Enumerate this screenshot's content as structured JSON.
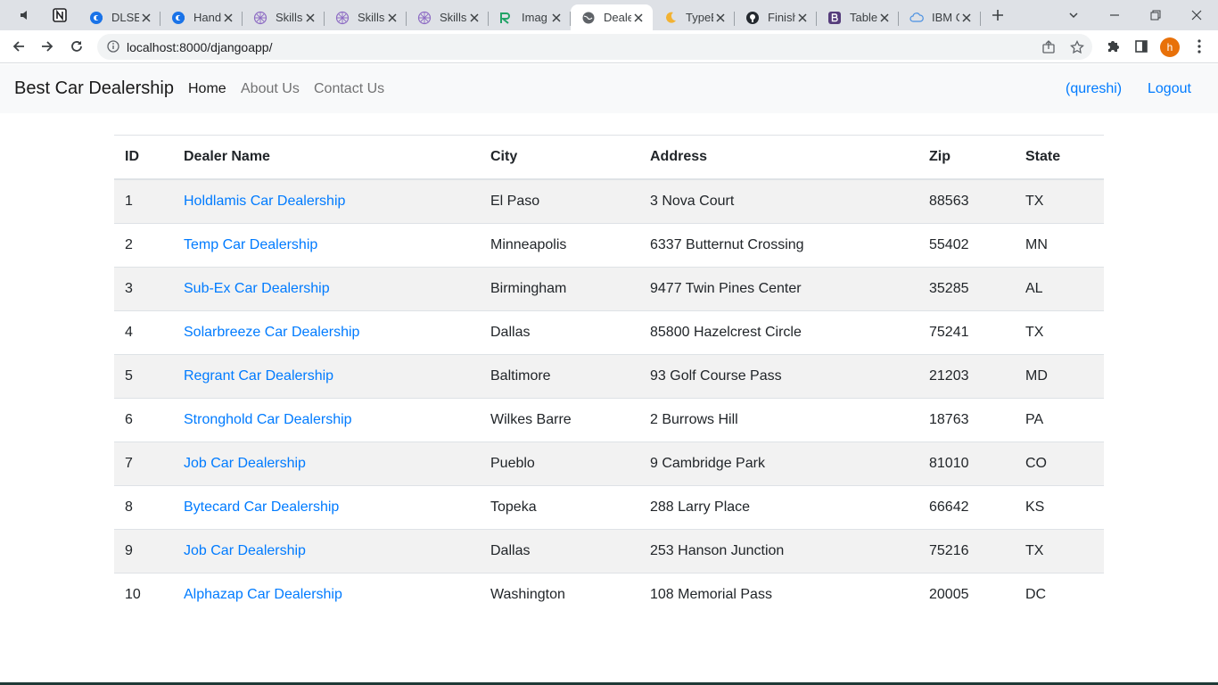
{
  "browser": {
    "tabs": [
      {
        "title": "DLSE",
        "icon": "chrome-c-icon"
      },
      {
        "title": "Hand",
        "icon": "chrome-c-icon"
      },
      {
        "title": "Skills",
        "icon": "skills-network-icon"
      },
      {
        "title": "Skills",
        "icon": "skills-network-icon"
      },
      {
        "title": "Skills",
        "icon": "skills-network-icon"
      },
      {
        "title": "Imag",
        "icon": "green-r-icon"
      },
      {
        "title": "Deale",
        "icon": "globe-icon"
      },
      {
        "title": "TypeE",
        "icon": "moon-icon"
      },
      {
        "title": "Finish",
        "icon": "github-icon"
      },
      {
        "title": "Table",
        "icon": "bootstrap-icon"
      },
      {
        "title": "IBM C",
        "icon": "cloud-icon"
      }
    ],
    "url": "localhost:8000/djangoapp/",
    "profile_initial": "h"
  },
  "navbar": {
    "brand": "Best Car Dealership",
    "links": [
      "Home",
      "About Us",
      "Contact Us"
    ],
    "user": "(qureshi)",
    "logout": "Logout"
  },
  "table": {
    "headers": [
      "ID",
      "Dealer Name",
      "City",
      "Address",
      "Zip",
      "State"
    ],
    "rows": [
      [
        "1",
        "Holdlamis Car Dealership",
        "El Paso",
        "3 Nova Court",
        "88563",
        "TX"
      ],
      [
        "2",
        "Temp Car Dealership",
        "Minneapolis",
        "6337 Butternut Crossing",
        "55402",
        "MN"
      ],
      [
        "3",
        "Sub-Ex Car Dealership",
        "Birmingham",
        "9477 Twin Pines Center",
        "35285",
        "AL"
      ],
      [
        "4",
        "Solarbreeze Car Dealership",
        "Dallas",
        "85800 Hazelcrest Circle",
        "75241",
        "TX"
      ],
      [
        "5",
        "Regrant Car Dealership",
        "Baltimore",
        "93 Golf Course Pass",
        "21203",
        "MD"
      ],
      [
        "6",
        "Stronghold Car Dealership",
        "Wilkes Barre",
        "2 Burrows Hill",
        "18763",
        "PA"
      ],
      [
        "7",
        "Job Car Dealership",
        "Pueblo",
        "9 Cambridge Park",
        "81010",
        "CO"
      ],
      [
        "8",
        "Bytecard Car Dealership",
        "Topeka",
        "288 Larry Place",
        "66642",
        "KS"
      ],
      [
        "9",
        "Job Car Dealership",
        "Dallas",
        "253 Hanson Junction",
        "75216",
        "TX"
      ],
      [
        "10",
        "Alphazap Car Dealership",
        "Washington",
        "108 Memorial Pass",
        "20005",
        "DC"
      ]
    ]
  },
  "colors": {
    "link": "#007bff",
    "navbar_bg": "#f8f9fa",
    "stripe": "#f2f2f2",
    "tabstrip_bg": "#dee1e6",
    "profile": "#e8710a"
  }
}
